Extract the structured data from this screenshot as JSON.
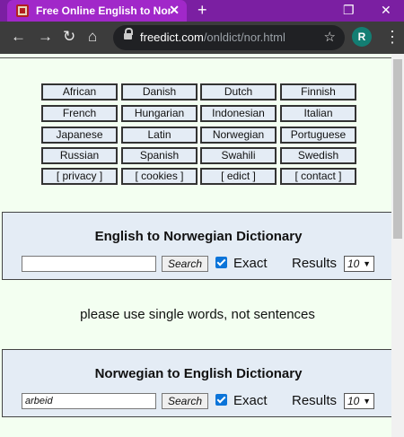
{
  "browser": {
    "tab_title": "Free Online English to Norwegian",
    "url_host": "freedict.com",
    "url_path": "/onldict/nor.html",
    "profile_initial": "R"
  },
  "languages": [
    [
      "African",
      "Danish",
      "Dutch",
      "Finnish"
    ],
    [
      "French",
      "Hungarian",
      "Indonesian",
      "Italian"
    ],
    [
      "Japanese",
      "Latin",
      "Norwegian",
      "Portuguese"
    ],
    [
      "Russian",
      "Spanish",
      "Swahili",
      "Swedish"
    ],
    [
      "[ privacy ]",
      "[ cookies ]",
      "[ edict ]",
      "[ contact ]"
    ]
  ],
  "eng_to_nor": {
    "title": "English to Norwegian Dictionary",
    "input_value": "",
    "search_label": "Search",
    "exact_label": "Exact",
    "exact_checked": true,
    "results_label": "Results",
    "results_value": "10"
  },
  "hint": "please use single words, not sentences",
  "nor_to_eng": {
    "title": "Norwegian to English Dictionary",
    "input_value": "arbeid",
    "search_label": "Search",
    "exact_label": "Exact",
    "exact_checked": true,
    "results_label": "Results",
    "results_value": "10"
  }
}
